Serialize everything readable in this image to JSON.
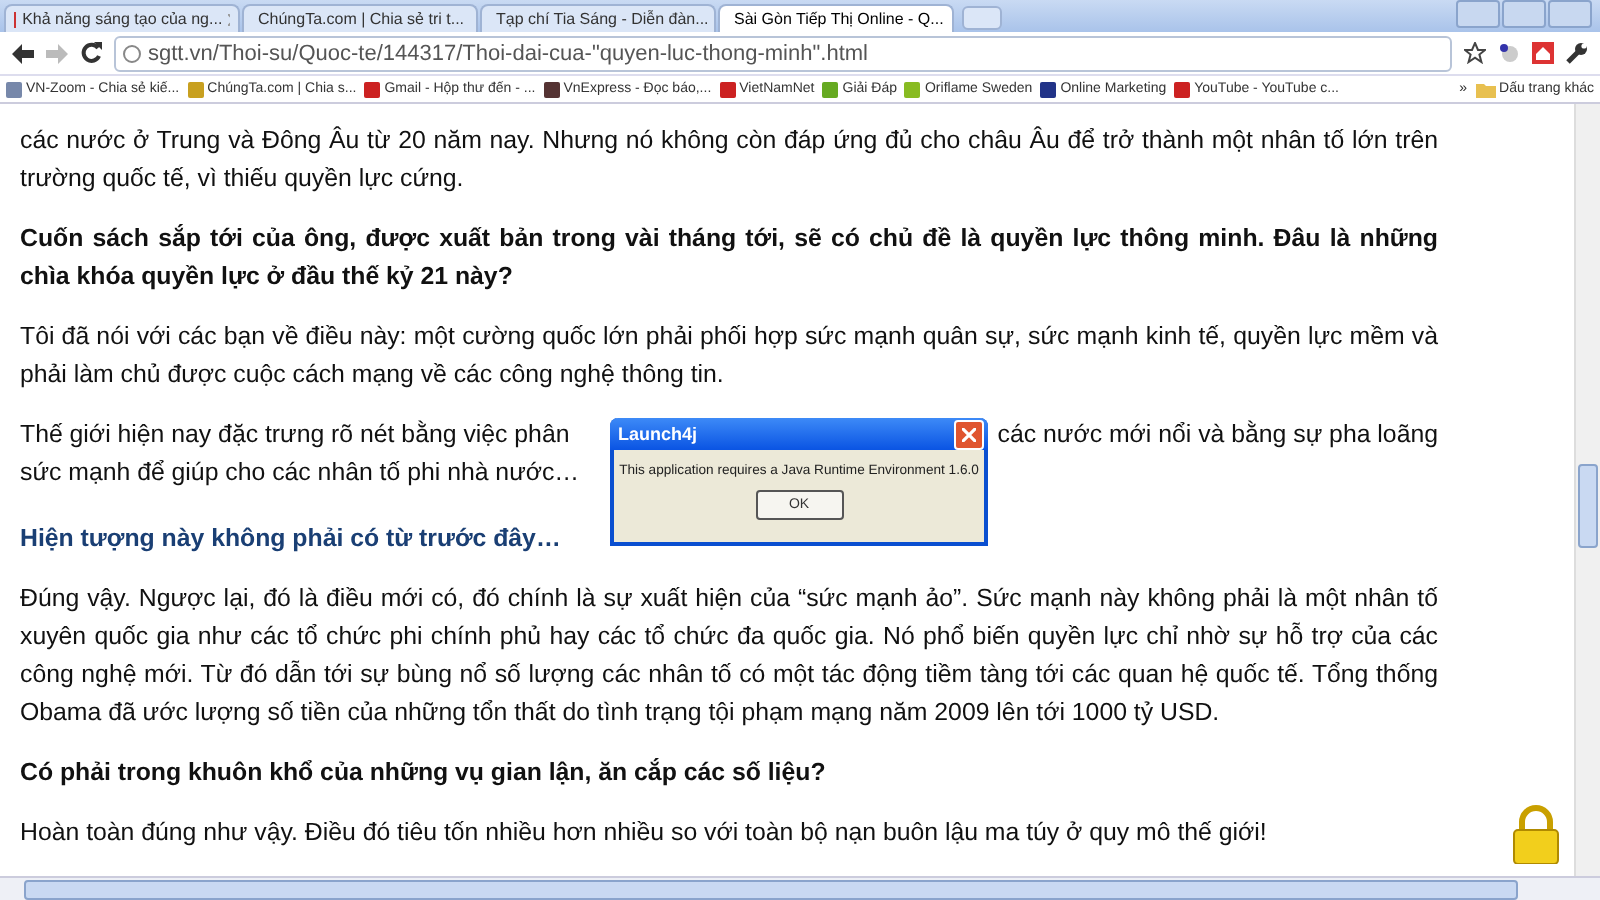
{
  "tabs": [
    {
      "title": "Khả năng sáng tạo của ng...",
      "selected": false
    },
    {
      "title": "ChúngTa.com | Chia sẻ tri t...",
      "selected": false
    },
    {
      "title": "Tạp chí Tia Sáng - Diễn đàn...",
      "selected": false
    },
    {
      "title": "Sài Gòn Tiếp Thị Online - Q...",
      "selected": true
    }
  ],
  "address_bar": {
    "url": "sgtt.vn/Thoi-su/Quoc-te/144317/Thoi-dai-cua-\"quyen-luc-thong-minh\".html"
  },
  "bookmarks": [
    "VN-Zoom - Chia sẻ kiế...",
    "ChúngTa.com | Chia s...",
    "Gmail - Hộp thư đến - ...",
    "VnExpress - Đọc báo,...",
    "VietNamNet",
    "Giải Đáp",
    "Oriflame Sweden",
    "Online Marketing",
    "YouTube - YouTube c..."
  ],
  "more_bookmarks": "»",
  "other_bookmarks": "Dấu trang khác",
  "article": [
    {
      "kind": "text",
      "text": "các nước ở Trung và Đông Âu từ 20 năm nay. Nhưng nó không còn đáp ứng đủ cho châu Âu để trở thành một nhân tố lớn trên trường quốc tế, vì thiếu quyền lực cứng."
    },
    {
      "kind": "question",
      "text": "Cuốn sách sắp tới của ông, được xuất bản trong vài tháng tới, sẽ có chủ đề là quyền lực thông minh. Đâu là những chìa khóa quyền lực ở đầu thế kỷ 21 này?"
    },
    {
      "kind": "text",
      "text": "Tôi đã nói với các bạn về điều này: một cường quốc lớn phải phối hợp sức mạnh quân sự, sức mạnh kinh tế, quyền lực mềm và phải làm chủ được cuộc cách mạng về các công nghệ thông tin."
    },
    {
      "kind": "split",
      "lines": [
        [
          "Thế giới hiện nay đặc trưng rõ nét bằng việc phân",
          "các nước mới nổi và bằng sự pha loãng"
        ],
        [
          "sức mạnh để giúp cho các nhân tố phi nhà nước…"
        ]
      ]
    },
    {
      "kind": "heading",
      "text": "Hiện tượng này không phải có từ trước đây…"
    },
    {
      "kind": "text",
      "text": "Đúng vậy. Ngược lại, đó là điều mới có, đó chính là sự xuất hiện của “sức mạnh ảo”. Sức mạnh này không phải là một nhân tố xuyên quốc gia như các tổ chức phi chính phủ hay các tổ chức đa quốc gia. Nó phổ biến quyền lực chỉ nhờ sự hỗ trợ của các công nghệ mới. Từ đó dẫn tới sự bùng nổ số lượng các nhân tố có một tác động tiềm tàng tới các quan hệ quốc tế. Tổng thống Obama đã ước lượng số tiền của những tổn thất do tình trạng tội phạm mạng năm 2009 lên tới 1000 tỷ USD."
    },
    {
      "kind": "question",
      "text": "Có phải trong khuôn khổ của những vụ gian lận, ăn cắp các số liệu?"
    },
    {
      "kind": "text",
      "text": "Hoàn toàn đúng như vậy. Điều đó tiêu tốn nhiều hơn nhiều so với toàn bộ nạn buôn lậu ma túy ở quy mô thế giới!"
    }
  ],
  "dialog": {
    "title": "Launch4j",
    "message": "This application requires a Java Runtime Environment 1.6.0",
    "buttons": [
      "OK"
    ]
  }
}
